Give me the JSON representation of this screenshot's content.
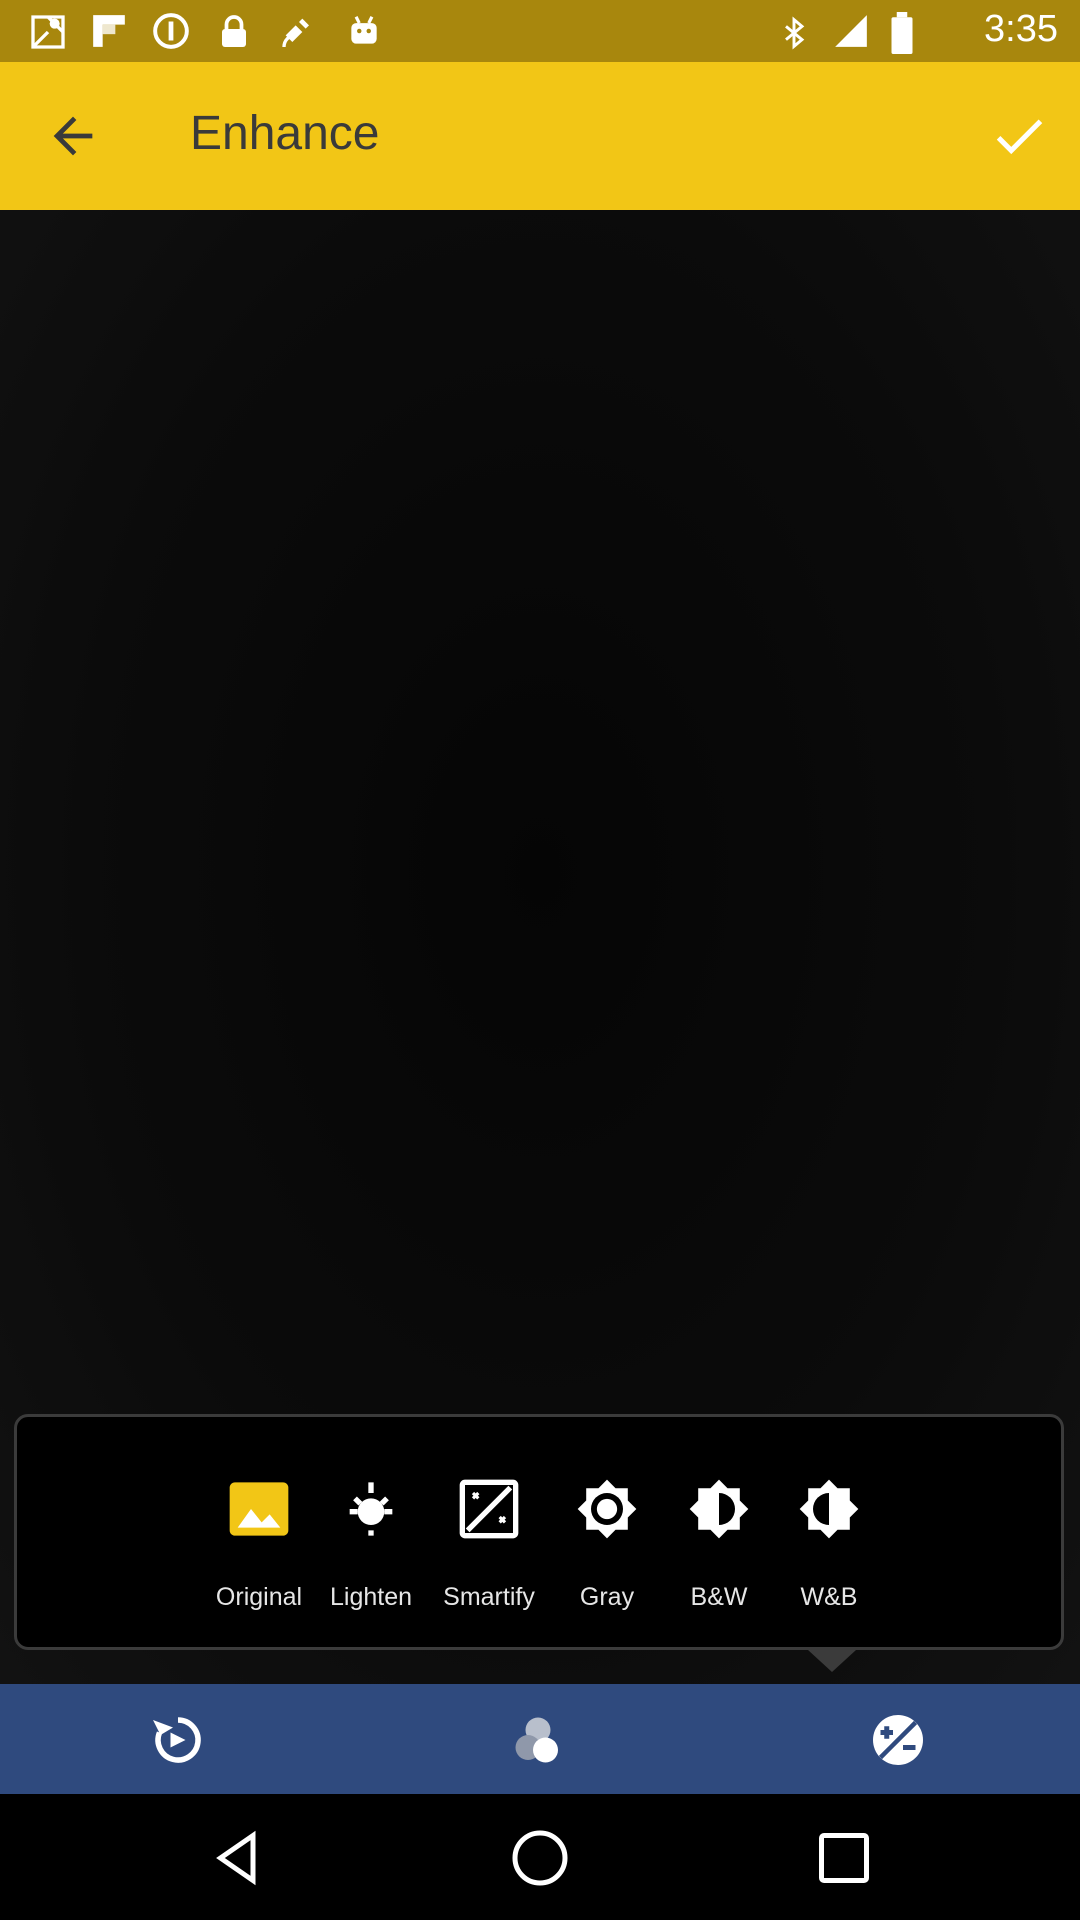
{
  "status_bar": {
    "time": "3:35",
    "icons": [
      "maps-icon",
      "flipboard-icon",
      "data-saver-icon",
      "lock-icon",
      "satellite-icon",
      "android-icon",
      "bluetooth-icon",
      "signal-icon",
      "battery-icon"
    ]
  },
  "app_bar": {
    "title": "Enhance",
    "back_icon": "arrow-back-icon",
    "confirm_icon": "checkmark-icon",
    "background": "#f2c616"
  },
  "filters": [
    {
      "label": "Original",
      "icon": "image-icon",
      "active": true
    },
    {
      "label": "Lighten",
      "icon": "bulb-icon"
    },
    {
      "label": "Smartify",
      "icon": "magic-icon"
    },
    {
      "label": "Gray",
      "icon": "brightness-gray-icon"
    },
    {
      "label": "B&W",
      "icon": "brightness-half-icon"
    },
    {
      "label": "W&B",
      "icon": "brightness-inverse-icon"
    }
  ],
  "toolbar": {
    "background": "#2f4a7e",
    "items": [
      "rotate-icon",
      "color-filters-icon",
      "exposure-icon"
    ]
  },
  "nav_bar": {
    "items": [
      "back-triangle-icon",
      "home-circle-icon",
      "recents-square-icon"
    ]
  }
}
